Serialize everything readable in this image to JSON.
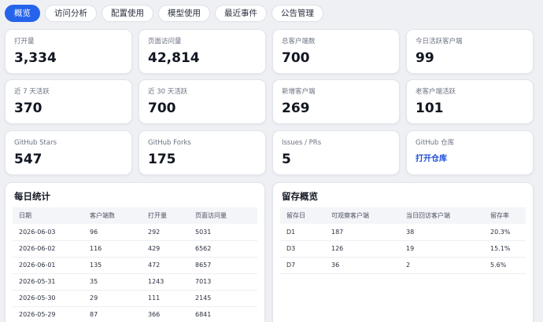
{
  "tabs": [
    "概览",
    "访问分析",
    "配置使用",
    "模型使用",
    "最近事件",
    "公告管理"
  ],
  "stats": [
    {
      "label": "打开量",
      "value": "3,334"
    },
    {
      "label": "页面访问量",
      "value": "42,814"
    },
    {
      "label": "总客户端数",
      "value": "700"
    },
    {
      "label": "今日活跃客户端",
      "value": "99"
    },
    {
      "label": "近 7 天活跃",
      "value": "370"
    },
    {
      "label": "近 30 天活跃",
      "value": "700"
    },
    {
      "label": "新增客户端",
      "value": "269"
    },
    {
      "label": "老客户端活跃",
      "value": "101"
    },
    {
      "label": "GitHub Stars",
      "value": "547"
    },
    {
      "label": "GitHub Forks",
      "value": "175"
    },
    {
      "label": "Issues / PRs",
      "value": "5"
    },
    {
      "label": "GitHub 仓库",
      "link": "打开仓库"
    }
  ],
  "daily": {
    "title": "每日统计",
    "columns": [
      "日期",
      "客户端数",
      "打开量",
      "页面访问量"
    ],
    "rows": [
      [
        "2026-06-03",
        "96",
        "292",
        "5031"
      ],
      [
        "2026-06-02",
        "116",
        "429",
        "6562"
      ],
      [
        "2026-06-01",
        "135",
        "472",
        "8657"
      ],
      [
        "2026-05-31",
        "35",
        "1243",
        "7013"
      ],
      [
        "2026-05-30",
        "29",
        "111",
        "2145"
      ],
      [
        "2026-05-29",
        "87",
        "366",
        "6841"
      ]
    ]
  },
  "retention": {
    "title": "留存概览",
    "columns": [
      "留存日",
      "可观察客户端",
      "当日回访客户端",
      "留存率"
    ],
    "rows": [
      [
        "D1",
        "187",
        "38",
        "20.3%"
      ],
      [
        "D3",
        "126",
        "19",
        "15.1%"
      ],
      [
        "D7",
        "36",
        "2",
        "5.6%"
      ]
    ]
  }
}
